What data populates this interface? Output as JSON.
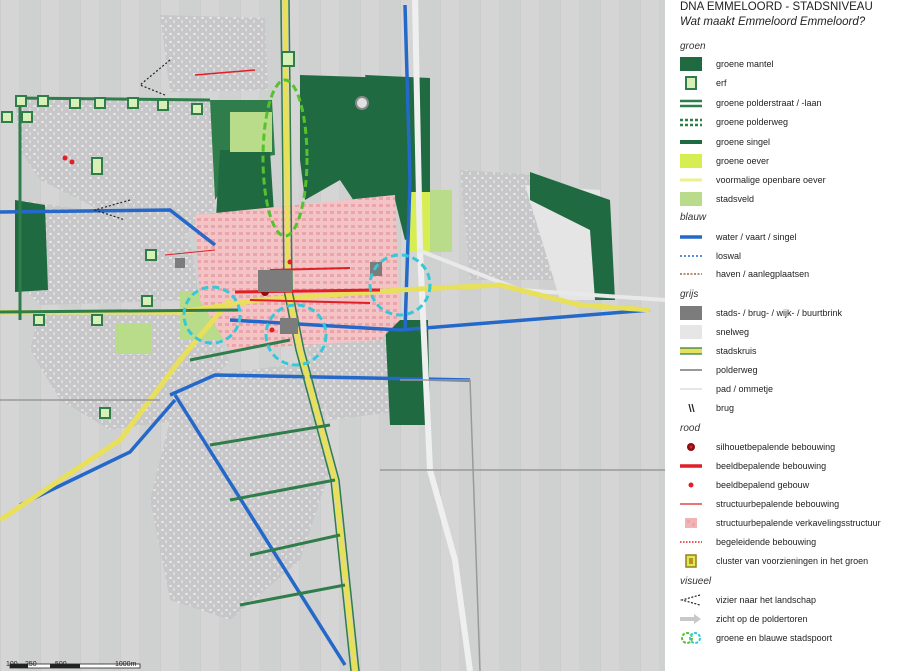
{
  "header": {
    "title": "DNA EMMELOORD - STADSNIVEAU",
    "subtitle": "Wat maakt Emmeloord Emmeloord?"
  },
  "legend": {
    "sections": [
      {
        "title": "groen",
        "items": [
          {
            "label": "groene mantel",
            "icon": "dark-green-square"
          },
          {
            "label": "erf",
            "icon": "green-outline-square"
          },
          {
            "label": "groene polderstraat / -laan",
            "icon": "double-green-line"
          },
          {
            "label": "groene polderweg",
            "icon": "dashed-green-line"
          },
          {
            "label": "groene singel",
            "icon": "thick-green-line"
          },
          {
            "label": "groene oever",
            "icon": "lime-square"
          },
          {
            "label": "voormalige openbare oever",
            "icon": "pale-yellow-line"
          },
          {
            "label": "stadsveld",
            "icon": "light-green-square"
          }
        ]
      },
      {
        "title": "blauw",
        "items": [
          {
            "label": "water / vaart / singel",
            "icon": "blue-line"
          },
          {
            "label": "loswal",
            "icon": "dotted-blue-line"
          },
          {
            "label": "haven / aanlegplaatsen",
            "icon": "dotted-brown-line"
          }
        ]
      },
      {
        "title": "grijs",
        "items": [
          {
            "label": "stads- / brug- / wijk- / buurtbrink",
            "icon": "dark-gray-square"
          },
          {
            "label": "snelweg",
            "icon": "light-gray-square"
          },
          {
            "label": "stadskruis",
            "icon": "yellow-double-line"
          },
          {
            "label": "polderweg",
            "icon": "gray-line"
          },
          {
            "label": "pad / ommetje",
            "icon": "thin-white-line"
          },
          {
            "label": "brug",
            "icon": "bridge-symbol"
          }
        ]
      },
      {
        "title": "rood",
        "items": [
          {
            "label": "silhouetbepalende bebouwing",
            "icon": "dark-red-dot"
          },
          {
            "label": "beeldbepalende bebouwing",
            "icon": "red-thick-line"
          },
          {
            "label": "beeldbepalend gebouw",
            "icon": "red-dot"
          },
          {
            "label": "structuurbepalende bebouwing",
            "icon": "red-thin-line"
          },
          {
            "label": "structuurbepalende verkavelingsstructuur",
            "icon": "pink-square"
          },
          {
            "label": "begeleidende bebouwing",
            "icon": "dotted-red-line"
          },
          {
            "label": "cluster van voorzieningen in het groen",
            "icon": "cluster-symbol"
          }
        ]
      },
      {
        "title": "visueel",
        "items": [
          {
            "label": "vizier naar het landschap",
            "icon": "dotted-chevron"
          },
          {
            "label": "zicht op de poldertoren",
            "icon": "gray-arrow"
          },
          {
            "label": "groene en blauwe stadspoort",
            "icon": "green-blue-circles"
          }
        ]
      }
    ]
  },
  "scale_bar": {
    "labels": [
      "100",
      "250",
      "500",
      "1000m"
    ]
  },
  "colors": {
    "dark_green": "#1f6a41",
    "mid_green": "#2f7d4b",
    "lime": "#d6ee52",
    "light_green": "#b9dc8a",
    "water_blue": "#2468c9",
    "yellow_road": "#e8e05a",
    "red": "#e01f26",
    "pink": "#f2b3b6",
    "cyan": "#36c8d8"
  }
}
